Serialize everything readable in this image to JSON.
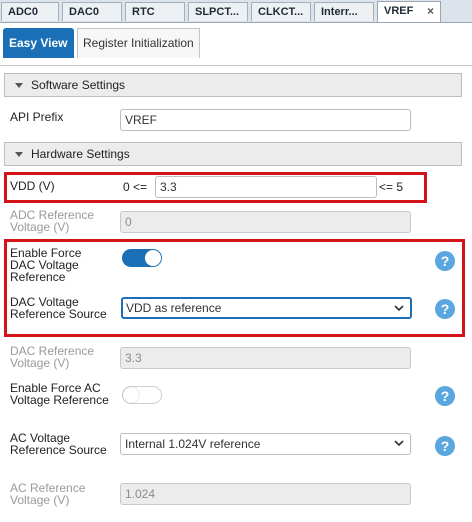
{
  "tabs": [
    {
      "label": "ADC0"
    },
    {
      "label": "DAC0"
    },
    {
      "label": "RTC"
    },
    {
      "label": "SLPCT..."
    },
    {
      "label": "CLKCT..."
    },
    {
      "label": "Interr..."
    },
    {
      "label": "VREF",
      "close": "×"
    }
  ],
  "subtabs": {
    "easy_view": "Easy View",
    "register_init": "Register Initialization"
  },
  "software_section": {
    "title": "Software Settings",
    "api_prefix_label": "API Prefix",
    "api_prefix_value": "VREF"
  },
  "hardware_section": {
    "title": "Hardware Settings"
  },
  "vdd": {
    "label": "VDD (V)",
    "min_text": "0 <=",
    "value": "3.3",
    "max_text": "<= 5"
  },
  "adc_ref": {
    "label": "ADC Reference Voltage (V)",
    "value": "0"
  },
  "force_dac": {
    "label": "Enable Force DAC Voltage Reference",
    "state": "on"
  },
  "dac_source": {
    "label": "DAC Voltage Reference Source",
    "value": "VDD as reference"
  },
  "dac_ref": {
    "label": "DAC Reference Voltage (V)",
    "value": "3.3"
  },
  "force_ac": {
    "label": "Enable Force AC Voltage Reference",
    "state": "off"
  },
  "ac_source": {
    "label": "AC Voltage Reference Source",
    "value": "Internal 1.024V reference"
  },
  "ac_ref": {
    "label": "AC Reference Voltage (V)",
    "value": "1.024"
  },
  "help": {
    "symbol": "?"
  },
  "colors": {
    "accent": "#1a6fb6",
    "highlight": "#d4121a",
    "help": "#5aa6de"
  }
}
